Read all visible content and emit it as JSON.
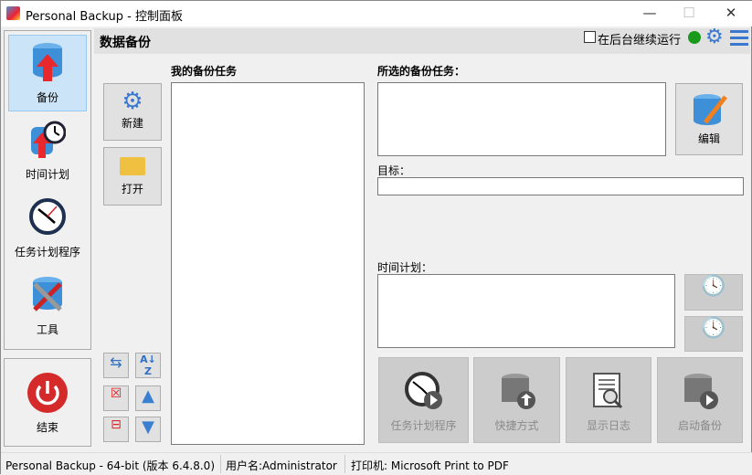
{
  "window": {
    "title": "Personal Backup - 控制面板",
    "minimize": "—",
    "maximize": "☐",
    "close": "✕"
  },
  "sidebar": {
    "items": [
      {
        "label": "备份",
        "icon": "database-backup-icon"
      },
      {
        "label": "时间计划",
        "icon": "schedule-icon"
      },
      {
        "label": "任务计划程序",
        "icon": "clock-icon"
      },
      {
        "label": "工具",
        "icon": "tools-icon"
      }
    ],
    "end": "结束"
  },
  "header": {
    "title": "数据备份",
    "background_checkbox": "在后台继续运行",
    "status_color": "#1a9a1a"
  },
  "tasks": {
    "label": "我的备份任务",
    "new": "新建",
    "open": "打开"
  },
  "selected": {
    "label": "所选的备份任务：",
    "edit": "编辑",
    "target_label": "目标：",
    "target_value": "",
    "schedule_label": "时间计划："
  },
  "actions": [
    "任务计划程序",
    "快捷方式",
    "显示日志",
    "启动备份"
  ],
  "status": {
    "version": "Personal Backup - 64-bit (版本 6.4.8.0)",
    "user": "用户名:Administrator",
    "printer": "打印机: Microsoft Print to PDF"
  }
}
